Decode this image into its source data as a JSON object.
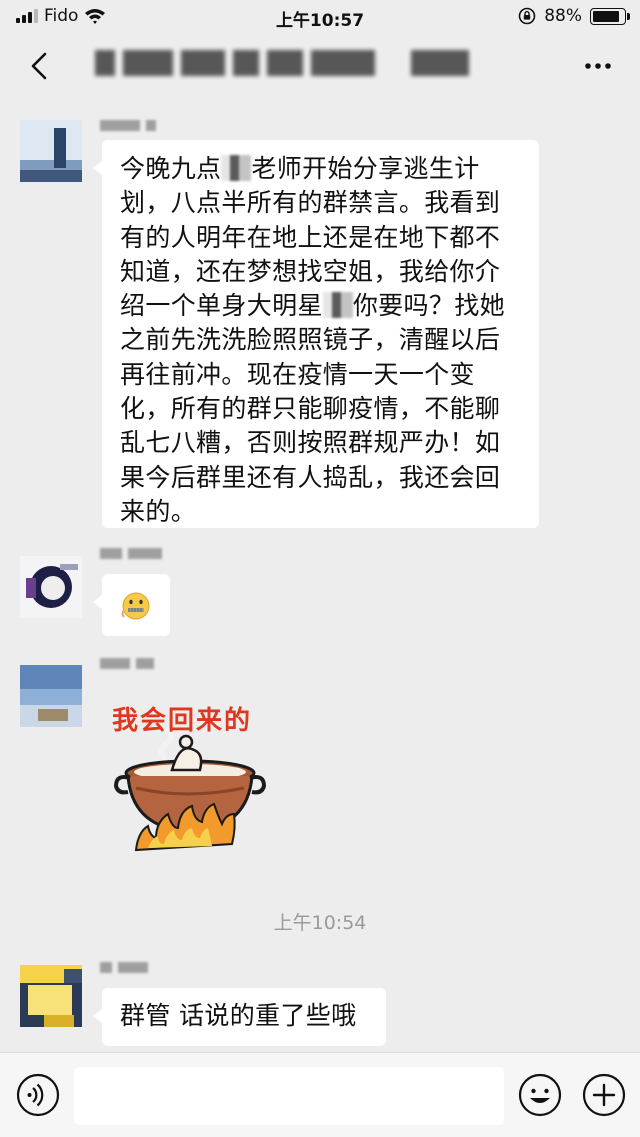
{
  "status_bar": {
    "carrier": "Fido",
    "time": "上午10:57",
    "battery": "88%",
    "battery_level": 0.88
  },
  "nav": {
    "title": "",
    "back_icon": "chevron-left-icon",
    "more_icon": "ellipsis-icon"
  },
  "messages": [
    {
      "type": "text",
      "segments": [
        "今晚九点",
        "老师开始分享逃生计划，八点半所有的群禁言。我看到有的人明年在地上还是在地下都不知道，还在梦想找空姐，我给你介绍一个单身大明星",
        "你要吗？找她之前先洗洗脸照照镜子，清醒以后再往前冲。现在疫情一天一个变化，所有的群只能聊疫情，不能聊乱七八糟，否则按照群规严办！如果今后群里还有人捣乱，我还会回来的。"
      ]
    },
    {
      "type": "emoji",
      "emoji": "zipper-mouth-emoji"
    },
    {
      "type": "sticker",
      "caption": "我会回来的",
      "sticker": "cooking-pot-sticker"
    },
    {
      "type": "text",
      "text": "群管 话说的重了些哦"
    }
  ],
  "time_divider": "上午10:54",
  "input_bar": {
    "voice_icon": "voice-icon",
    "emoji_icon": "smiley-icon",
    "plus_icon": "plus-circle-icon"
  },
  "colors": {
    "background": "#ededed",
    "bubble": "#ffffff",
    "text": "#111111",
    "timestamp": "#9a9a9a"
  }
}
